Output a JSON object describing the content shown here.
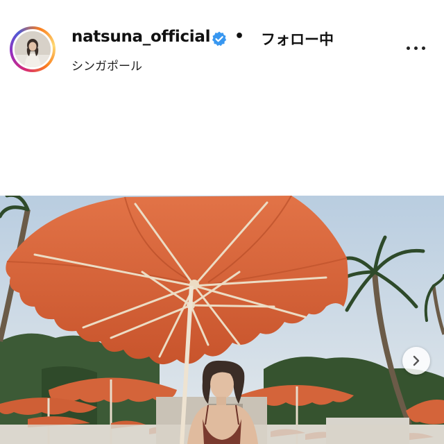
{
  "post_header": {
    "username": "natsuna_official",
    "separator": "•",
    "follow_state": "フォロー中",
    "location": "シンガポール",
    "verified_icon": "verified-badge-icon",
    "more_icon": "more-options-icon"
  },
  "post_photo": {
    "next_icon": "chevron-right-icon"
  },
  "colors": {
    "verified_blue": "#3897f0",
    "umbrella_orange": "#d8643a",
    "sky": "#c9d9e6"
  }
}
